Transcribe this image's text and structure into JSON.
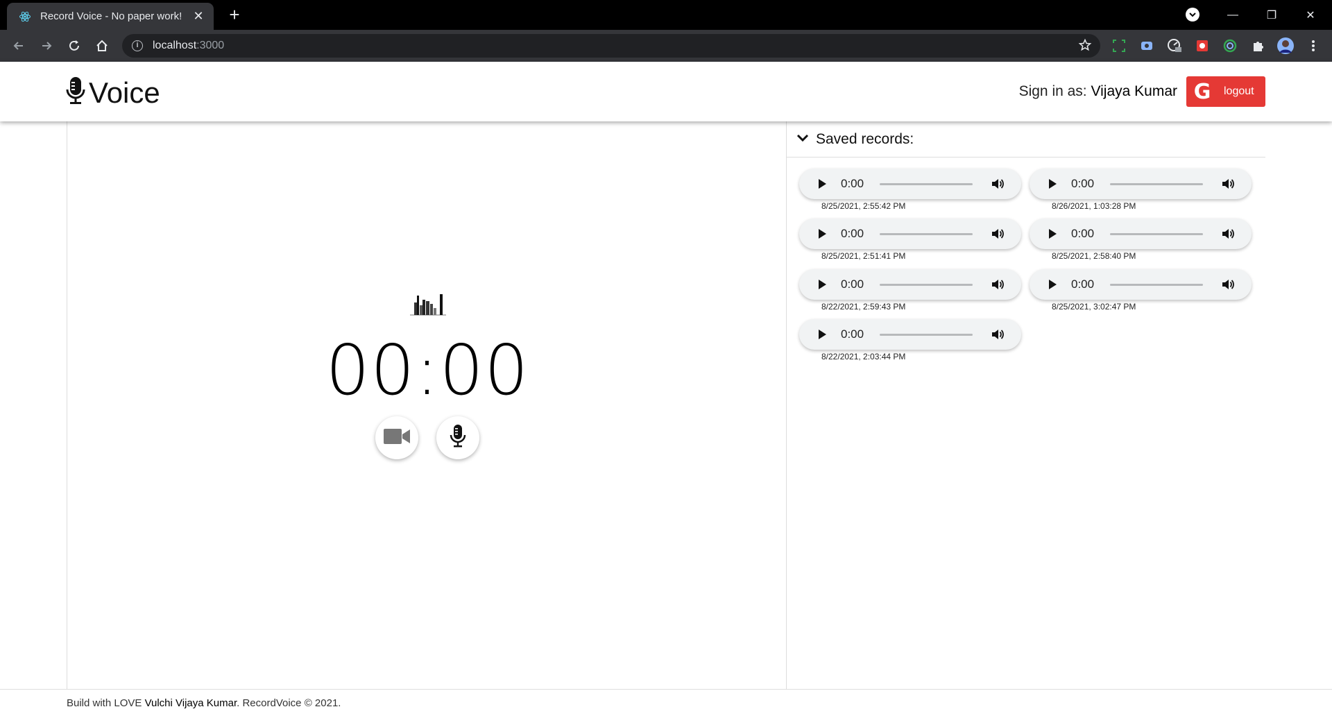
{
  "browser": {
    "tab_title": "Record Voice - No paper work!",
    "url_host": "localhost",
    "url_port": ":3000"
  },
  "header": {
    "brand": "Voice",
    "signin_prefix": "Sign in as:",
    "user_name": "Vijaya Kumar",
    "logout_label": "logout",
    "logout_glyph": "G"
  },
  "recorder": {
    "timer": "00:00"
  },
  "saved": {
    "title": "Saved records:",
    "records": [
      {
        "time": "0:00",
        "date": "8/25/2021, 2:55:42 PM"
      },
      {
        "time": "0:00",
        "date": "8/26/2021, 1:03:28 PM"
      },
      {
        "time": "0:00",
        "date": "8/25/2021, 2:51:41 PM"
      },
      {
        "time": "0:00",
        "date": "8/25/2021, 2:58:40 PM"
      },
      {
        "time": "0:00",
        "date": "8/22/2021, 2:59:43 PM"
      },
      {
        "time": "0:00",
        "date": "8/25/2021, 3:02:47 PM"
      },
      {
        "time": "0:00",
        "date": "8/22/2021, 2:03:44 PM"
      }
    ]
  },
  "footer": {
    "prefix": "Build with LOVE ",
    "author": "Vulchi Vijaya Kumar",
    "suffix": ". RecordVoice © 2021."
  },
  "colors": {
    "logout_bg": "#e53935",
    "player_bg": "#f1f3f4",
    "chrome_bg": "#35363a"
  }
}
